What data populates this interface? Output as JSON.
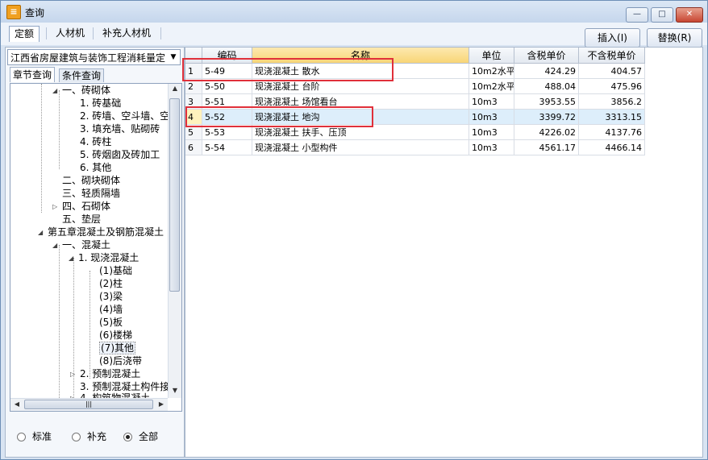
{
  "window": {
    "title": "查询",
    "min_label": "—",
    "max_label": "□",
    "close_label": "✕"
  },
  "menu": {
    "tabs": [
      "定额",
      "人材机",
      "补充人材机"
    ]
  },
  "toolbar": {
    "insert_label": "插入(I)",
    "replace_label": "替换(R)"
  },
  "left": {
    "library": "江西省房屋建筑与装饰工程消耗量定",
    "tabs": [
      "章节查询",
      "条件查询"
    ],
    "tree": [
      {
        "label": "一、砖砌体",
        "expanded": true
      },
      {
        "label": "1. 砖基础"
      },
      {
        "label": "2. 砖墙、空斗墙、空"
      },
      {
        "label": "3. 填充墙、贴砌砖"
      },
      {
        "label": "4. 砖柱"
      },
      {
        "label": "5. 砖烟囱及砖加工"
      },
      {
        "label": "6. 其他"
      },
      {
        "label": "二、砌块砌体"
      },
      {
        "label": "三、轻质隔墙"
      },
      {
        "label": "四、石砌体",
        "collapsed": true
      },
      {
        "label": "五、垫层"
      },
      {
        "label": "第五章混凝土及钢筋混凝土",
        "expanded": true
      },
      {
        "label": "一、混凝土",
        "expanded": true
      },
      {
        "label": "1. 现浇混凝土",
        "expanded": true
      },
      {
        "label": "(1)基础"
      },
      {
        "label": "(2)柱"
      },
      {
        "label": "(3)梁"
      },
      {
        "label": "(4)墙"
      },
      {
        "label": "(5)板"
      },
      {
        "label": "(6)楼梯"
      },
      {
        "label": "(7)其他",
        "selected": true
      },
      {
        "label": "(8)后浇带"
      },
      {
        "label": "2. 预制混凝土",
        "collapsed": true
      },
      {
        "label": "3. 预制混凝土构件接"
      },
      {
        "label": "4. 构筑物混凝土",
        "collapsed": true
      }
    ],
    "filter": {
      "options": [
        "标准",
        "补充",
        "全部"
      ],
      "selected": "全部"
    }
  },
  "table": {
    "headers": [
      "",
      "编码",
      "名称",
      "单位",
      "含税单价",
      "不含税单价"
    ],
    "rows": [
      {
        "idx": "1",
        "code": "5-49",
        "name": "现浇混凝土 散水",
        "unit": "10m2水平",
        "tax_price": "424.29",
        "notax_price": "404.57"
      },
      {
        "idx": "2",
        "code": "5-50",
        "name": "现浇混凝土 台阶",
        "unit": "10m2水平",
        "tax_price": "488.04",
        "notax_price": "475.96"
      },
      {
        "idx": "3",
        "code": "5-51",
        "name": "现浇混凝土 场馆看台",
        "unit": "10m3",
        "tax_price": "3953.55",
        "notax_price": "3856.2"
      },
      {
        "idx": "4",
        "code": "5-52",
        "name": "现浇混凝土 地沟",
        "unit": "10m3",
        "tax_price": "3399.72",
        "notax_price": "3313.15",
        "selected": true
      },
      {
        "idx": "5",
        "code": "5-53",
        "name": "现浇混凝土 扶手、压顶",
        "unit": "10m3",
        "tax_price": "4226.02",
        "notax_price": "4137.76"
      },
      {
        "idx": "6",
        "code": "5-54",
        "name": "现浇混凝土 小型构件",
        "unit": "10m3",
        "tax_price": "4561.17",
        "notax_price": "4466.14"
      }
    ]
  },
  "colors": {
    "highlight_box": "#e0303a",
    "selected_row": "#ddeefb",
    "sorted_header": "#f8d576"
  }
}
